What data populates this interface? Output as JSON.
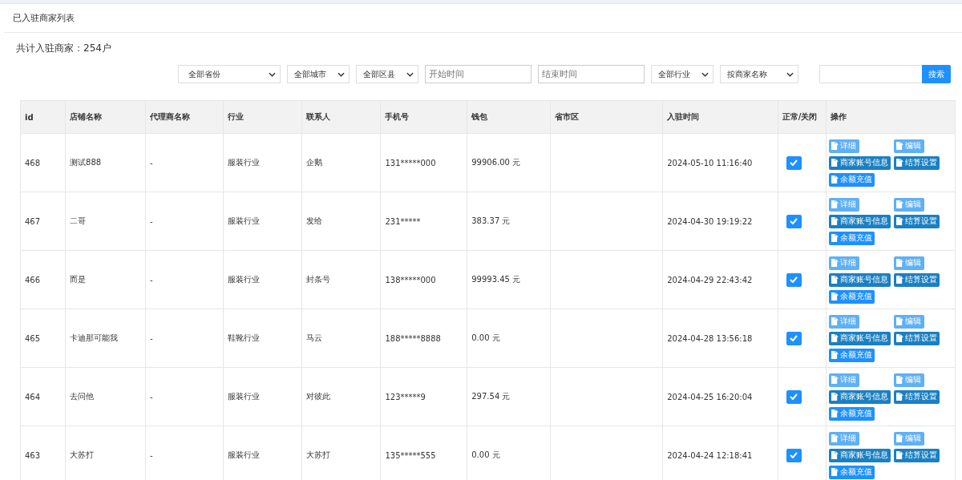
{
  "panel_title": "已入驻商家列表",
  "summary": "共计入驻商家：254户",
  "filters": [
    {
      "kind": "select",
      "value": "全部省份"
    },
    {
      "kind": "select",
      "value": "全部城市"
    },
    {
      "kind": "select",
      "value": "全部区县"
    },
    {
      "kind": "input",
      "placeholder": "开始时间"
    },
    {
      "kind": "input",
      "placeholder": "结束时间"
    },
    {
      "kind": "select",
      "value": "全部行业"
    },
    {
      "kind": "select",
      "value": "按商家名称"
    }
  ],
  "search": {
    "button": "搜索"
  },
  "table": {
    "columns": [
      "id",
      "店铺名称",
      "代理商名称",
      "行业",
      "联系人",
      "手机号",
      "钱包",
      "省市区",
      "入驻时间",
      "正常/关闭",
      "操作"
    ],
    "rows": [
      {
        "cells": [
          "468",
          "测试888",
          "-",
          "服装行业",
          "企鹅",
          "131*****000",
          "99906.00 元",
          "",
          "2024-05-10 11:16:40"
        ],
        "enabled": true,
        "actions": [
          {
            "label": "详细",
            "kind": "light"
          },
          {
            "label": "编辑",
            "kind": "light"
          },
          {
            "label": "商家账号信息",
            "kind": "dark"
          },
          {
            "label": "结算设置",
            "kind": "dark"
          },
          {
            "label": "余额充值",
            "kind": "primary"
          }
        ]
      },
      {
        "cells": [
          "467",
          "二哥",
          "-",
          "服装行业",
          "发给",
          "231*****",
          "383.37 元",
          "",
          "2024-04-30 19:19:22"
        ],
        "enabled": true,
        "actions": [
          {
            "label": "详细",
            "kind": "light"
          },
          {
            "label": "编辑",
            "kind": "light"
          },
          {
            "label": "商家账号信息",
            "kind": "dark"
          },
          {
            "label": "结算设置",
            "kind": "dark"
          },
          {
            "label": "余额充值",
            "kind": "primary"
          }
        ]
      },
      {
        "cells": [
          "466",
          "而是",
          "-",
          "服装行业",
          "封条号",
          "138*****000",
          "99993.45 元",
          "",
          "2024-04-29 22:43:42"
        ],
        "enabled": true,
        "actions": [
          {
            "label": "详细",
            "kind": "light"
          },
          {
            "label": "编辑",
            "kind": "light"
          },
          {
            "label": "商家账号信息",
            "kind": "dark"
          },
          {
            "label": "结算设置",
            "kind": "dark"
          },
          {
            "label": "余额充值",
            "kind": "primary"
          }
        ]
      },
      {
        "cells": [
          "465",
          "卡迪那可能我",
          "-",
          "鞋靴行业",
          "马云",
          "188*****8888",
          "0.00 元",
          "",
          "2024-04-28 13:56:18"
        ],
        "enabled": true,
        "actions": [
          {
            "label": "详细",
            "kind": "light"
          },
          {
            "label": "编辑",
            "kind": "light"
          },
          {
            "label": "商家账号信息",
            "kind": "dark"
          },
          {
            "label": "结算设置",
            "kind": "dark"
          },
          {
            "label": "余额充值",
            "kind": "primary"
          }
        ]
      },
      {
        "cells": [
          "464",
          "去问他",
          "-",
          "服装行业",
          "对彼此",
          "123*****9",
          "297.54 元",
          "",
          "2024-04-25 16:20:04"
        ],
        "enabled": true,
        "actions": [
          {
            "label": "详细",
            "kind": "light"
          },
          {
            "label": "编辑",
            "kind": "light"
          },
          {
            "label": "商家账号信息",
            "kind": "dark"
          },
          {
            "label": "结算设置",
            "kind": "dark"
          },
          {
            "label": "余额充值",
            "kind": "primary"
          }
        ]
      },
      {
        "cells": [
          "463",
          "大苏打",
          "-",
          "服装行业",
          "大苏打",
          "135*****555",
          "0.00 元",
          "",
          "2024-04-24 12:18:41"
        ],
        "enabled": true,
        "actions": [
          {
            "label": "详细",
            "kind": "light"
          },
          {
            "label": "编辑",
            "kind": "light"
          },
          {
            "label": "商家账号信息",
            "kind": "dark"
          },
          {
            "label": "结算设置",
            "kind": "dark"
          },
          {
            "label": "余额充值",
            "kind": "primary"
          }
        ]
      }
    ]
  }
}
